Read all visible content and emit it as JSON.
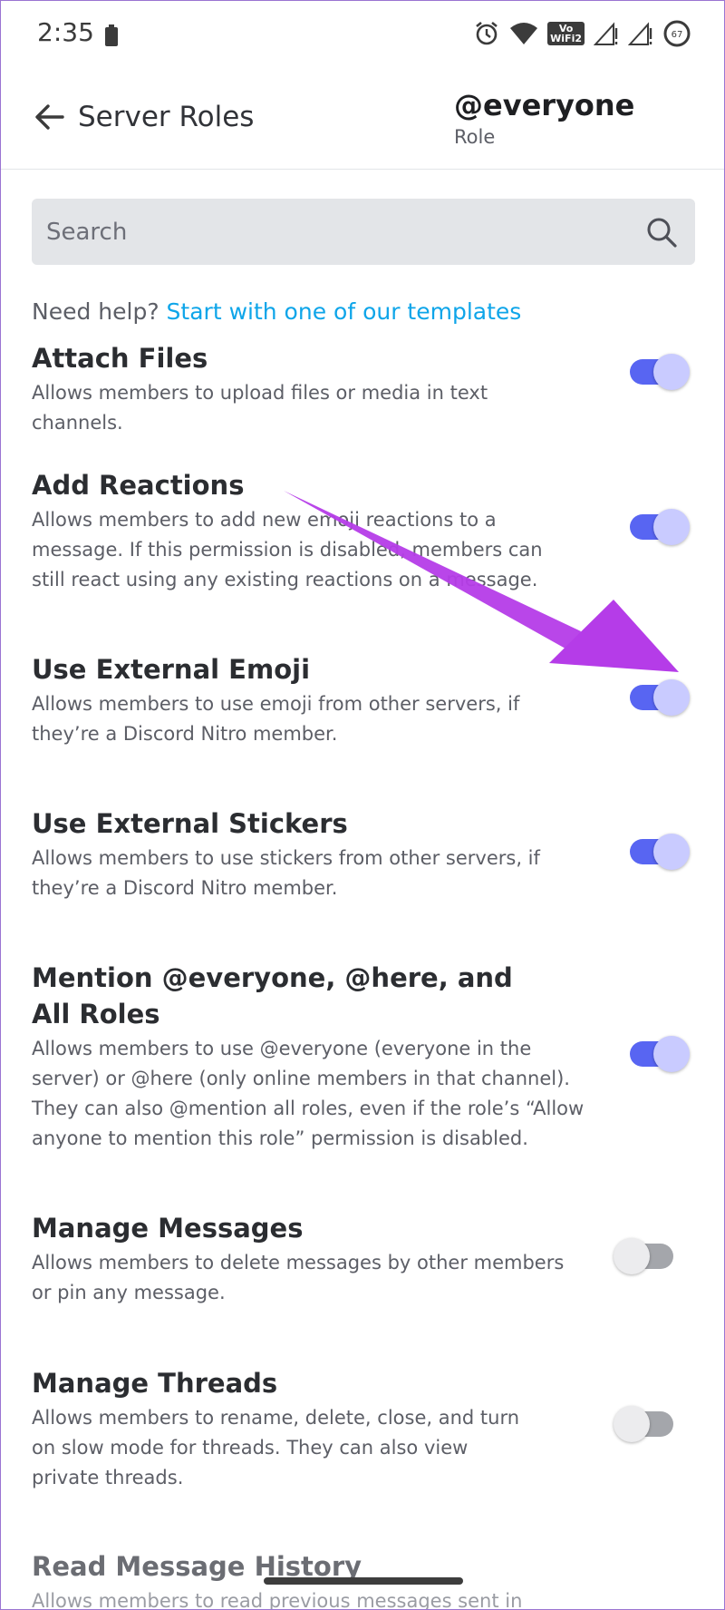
{
  "status_bar": {
    "time": "2:35",
    "wifi_badge_top": "Vo",
    "wifi_badge_bottom": "WiFi2",
    "battery_level": "67"
  },
  "header": {
    "title": "Server Roles",
    "role_name": "@everyone",
    "role_subtitle": "Role"
  },
  "search": {
    "placeholder": "Search"
  },
  "help": {
    "prefix": "Need help?",
    "link": "Start with one of our templates"
  },
  "permissions": [
    {
      "title": "Attach Files",
      "description": "Allows members to upload files or media in text channels.",
      "enabled": true
    },
    {
      "title": "Add Reactions",
      "description": "Allows members to add new emoji reactions to a message. If this permission is disabled, members can still react using any existing reactions on a message.",
      "enabled": true
    },
    {
      "title": "Use External Emoji",
      "description": "Allows members to use emoji from other servers, if they’re a Discord Nitro member.",
      "enabled": true
    },
    {
      "title": "Use External Stickers",
      "description": "Allows members to use stickers from other servers, if they’re a Discord Nitro member.",
      "enabled": true
    },
    {
      "title": "Mention @everyone, @here, and All Roles",
      "description": "Allows members to use @everyone (everyone in the server) or @here (only online members in that channel). They can also @mention all roles, even if the role’s “Allow anyone to mention this role” permission is disabled.",
      "enabled": true
    },
    {
      "title": "Manage Messages",
      "description": "Allows members to delete messages by other members or pin any message.",
      "enabled": false
    },
    {
      "title": "Manage Threads",
      "description": "Allows members to rename, delete, close, and turn on slow mode for threads. They can also view private threads.",
      "enabled": false
    },
    {
      "title": "Read Message History",
      "description": "Allows members to read previous messages sent in"
    }
  ],
  "colors": {
    "accent": "#5865f2",
    "link": "#0ea5e9",
    "annotation_arrow": "#b53ce8"
  }
}
